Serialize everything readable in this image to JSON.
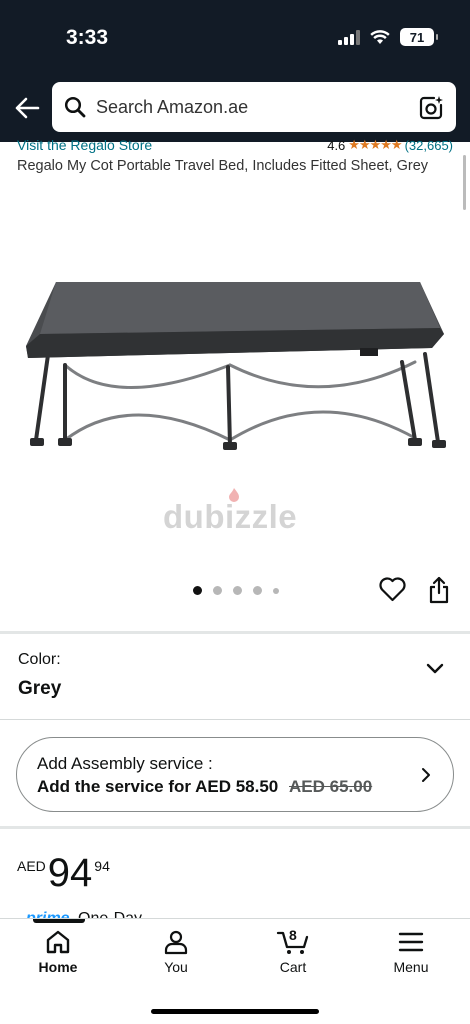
{
  "status_bar": {
    "time": "3:33",
    "battery": "71"
  },
  "search": {
    "placeholder": "Search Amazon.ae"
  },
  "product": {
    "store_link": "Visit the Regalo Store",
    "rating_value": "4.6",
    "rating_stars": "★★★★★",
    "rating_count": "(32,665)",
    "title": "Regalo My Cot Portable Travel Bed, Includes Fitted Sheet, Grey",
    "watermark": "dubizzle",
    "image_count": 5,
    "current_image": 1
  },
  "color": {
    "label": "Color:",
    "value": "Grey"
  },
  "assembly": {
    "title": "Add Assembly service :",
    "prefix": "Add the service for",
    "price": "AED 58.50",
    "old_price": "AED 65.00"
  },
  "price": {
    "currency": "AED",
    "whole": "94",
    "fraction": "94"
  },
  "delivery": {
    "prime": "prime",
    "speed": "One-Day"
  },
  "tabbar": {
    "home": "Home",
    "you": "You",
    "cart": "Cart",
    "cart_count": "8",
    "menu": "Menu"
  },
  "colors": {
    "header_bg": "#121b26",
    "link": "#007185",
    "star": "#de7921",
    "prime": "#1a98ff"
  }
}
